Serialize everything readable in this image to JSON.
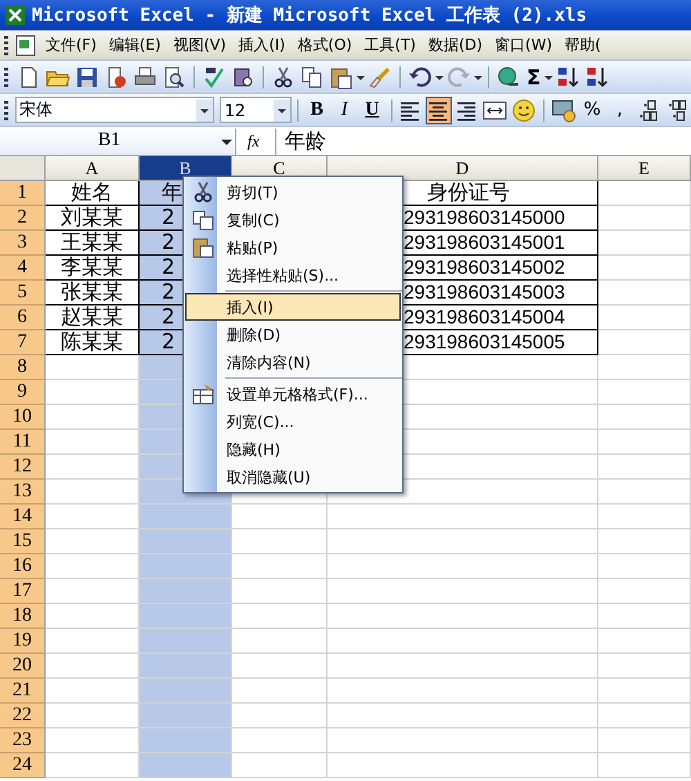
{
  "window": {
    "title": "Microsoft Excel - 新建 Microsoft Excel 工作表 (2).xls"
  },
  "menu_bar": [
    "文件(F)",
    "编辑(E)",
    "视图(V)",
    "插入(I)",
    "格式(O)",
    "工具(T)",
    "数据(D)",
    "窗口(W)",
    "帮助("
  ],
  "standard_toolbar": {
    "autosum": "Σ"
  },
  "formatting_toolbar": {
    "font": "宋体",
    "size": "12",
    "bold": "B",
    "italic": "I",
    "underline": "U",
    "alignment": [
      {
        "kind": "left",
        "selected": false
      },
      {
        "kind": "center",
        "selected": true
      },
      {
        "kind": "right",
        "selected": false
      }
    ],
    "percent": "%",
    "comma": ","
  },
  "formula_bar": {
    "name_box": "B1",
    "fx": "fx",
    "value": "年龄"
  },
  "sheet": {
    "columns": [
      {
        "label": "A",
        "selected": false
      },
      {
        "label": "B",
        "selected": true
      },
      {
        "label": "C",
        "selected": false
      },
      {
        "label": "D",
        "selected": false
      },
      {
        "label": "E",
        "selected": false
      }
    ],
    "rows": [
      {
        "number": "1",
        "cells": {
          "A": "姓名",
          "B": "年",
          "D": "身份证号"
        }
      },
      {
        "number": "2",
        "cells": {
          "A": "刘某某",
          "B": "2",
          "D": "293198603145000"
        }
      },
      {
        "number": "3",
        "cells": {
          "A": "王某某",
          "B": "2",
          "D": "293198603145001"
        }
      },
      {
        "number": "4",
        "cells": {
          "A": "李某某",
          "B": "2",
          "D": "293198603145002"
        }
      },
      {
        "number": "5",
        "cells": {
          "A": "张某某",
          "B": "2",
          "D": "293198603145003"
        }
      },
      {
        "number": "6",
        "cells": {
          "A": "赵某某",
          "B": "2",
          "D": "293198603145004"
        }
      },
      {
        "number": "7",
        "cells": {
          "A": "陈某某",
          "B": "2",
          "D": "293198603145005"
        }
      },
      {
        "number": "8"
      },
      {
        "number": "9"
      },
      {
        "number": "10"
      },
      {
        "number": "11"
      },
      {
        "number": "12"
      },
      {
        "number": "13"
      },
      {
        "number": "14"
      },
      {
        "number": "15"
      },
      {
        "number": "16"
      },
      {
        "number": "17"
      },
      {
        "number": "18"
      },
      {
        "number": "19"
      },
      {
        "number": "20"
      },
      {
        "number": "21"
      },
      {
        "number": "22"
      },
      {
        "number": "23"
      },
      {
        "number": "24"
      }
    ]
  },
  "context_menu": {
    "items": [
      {
        "label": "剪切(T)",
        "kind": "cut",
        "selected": false
      },
      {
        "label": "复制(C)",
        "kind": "copy",
        "selected": false
      },
      {
        "label": "粘贴(P)",
        "kind": "paste",
        "selected": false
      },
      {
        "label": "选择性粘贴(S)...",
        "kind": "text",
        "selected": false
      },
      {
        "label": "插入(I)",
        "kind": "text",
        "selected": true,
        "separator_before": true
      },
      {
        "label": "删除(D)",
        "kind": "text",
        "selected": false
      },
      {
        "label": "清除内容(N)",
        "kind": "text",
        "selected": false
      },
      {
        "label": "设置单元格格式(F)...",
        "kind": "format",
        "selected": false,
        "separator_before": true
      },
      {
        "label": "列宽(C)...",
        "kind": "text",
        "selected": false
      },
      {
        "label": "隐藏(H)",
        "kind": "text",
        "selected": false
      },
      {
        "label": "取消隐藏(U)",
        "kind": "text",
        "selected": false
      }
    ]
  }
}
